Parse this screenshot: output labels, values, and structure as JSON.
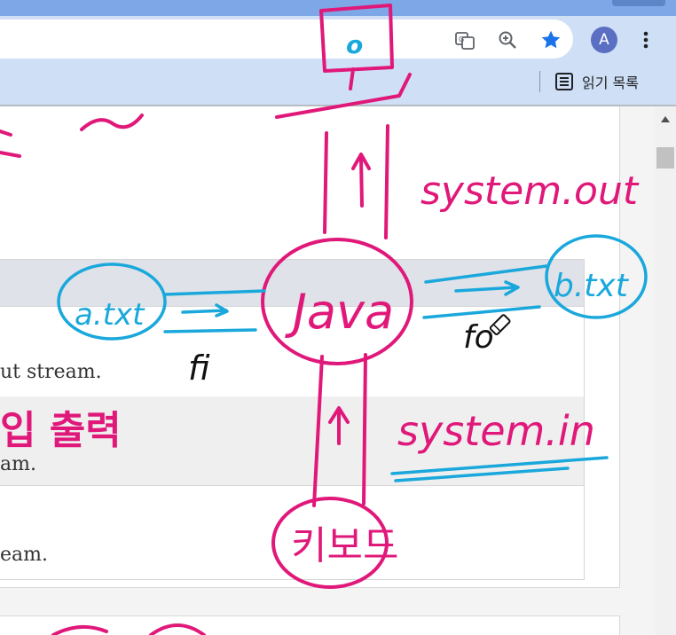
{
  "browser": {
    "avatar_letter": "A",
    "reading_list_label": "읽기 목록",
    "colors": {
      "accent": "#1a73e8",
      "toolbar": "#cedff6"
    }
  },
  "table": {
    "rows": [
      {
        "text": "ut stream."
      },
      {
        "text": "am."
      },
      {
        "text": "eam."
      }
    ]
  },
  "annotations": {
    "colors": {
      "magenta": "#e0187a",
      "cyan": "#1aa8dc",
      "black": "#111111"
    },
    "center": "Java",
    "top_screen": "o",
    "top_arrow_label": "system.out",
    "left_node": "a.txt",
    "left_label": "fi",
    "right_node": "b.txt",
    "right_label": "fo",
    "bottom_node": "키보드",
    "bottom_arrow_label": "system.in",
    "left_text": "입 출력",
    "top_tilde": "~"
  }
}
